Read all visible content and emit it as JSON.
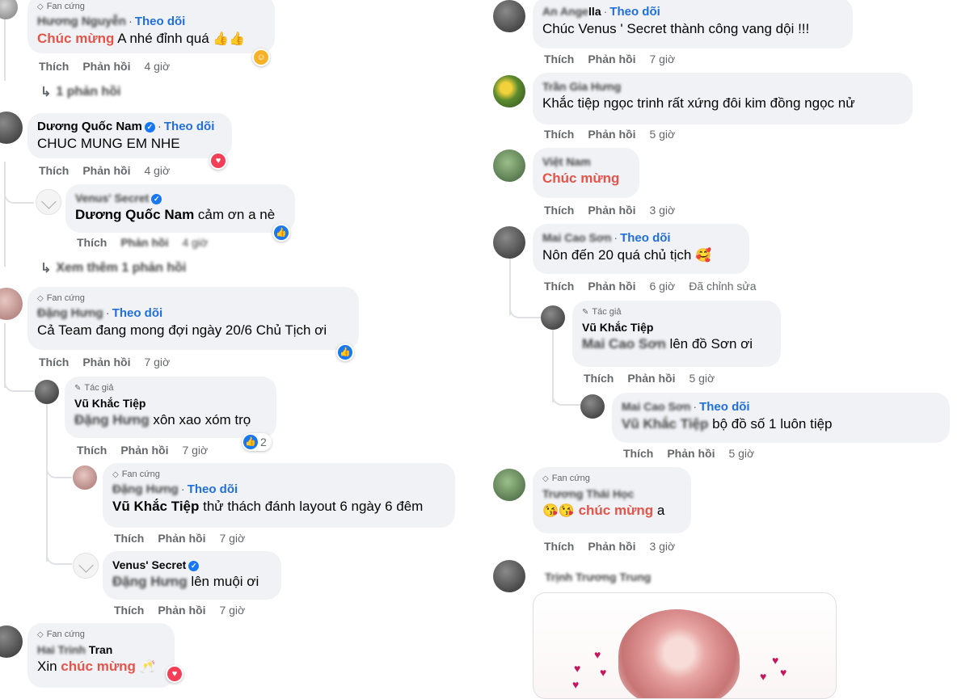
{
  "actions": {
    "like": "Thích",
    "reply": "Phản hồi"
  },
  "left": {
    "c1": {
      "name": "Hương Nguyễn",
      "badge": "Fan cứng",
      "follow": "Theo dõi",
      "text_hl": "Chúc mừng",
      "text_rest": " A nhé đỉnh quá",
      "time": "4 giờ",
      "more": "1 phản hồi"
    },
    "c2": {
      "name": "Dương Quốc Nam",
      "follow": "Theo dõi",
      "text": "CHUC MUNG EM NHE",
      "time": "4 giờ"
    },
    "c2r": {
      "name": "Venus' Secret",
      "mention": "Dương Quốc Nam",
      "text_rest": " cảm ơn a nè",
      "time": "4 giờ"
    },
    "c2more": "Xem thêm 1 phản hồi",
    "c3": {
      "badge": "Fan cứng",
      "name": "Đặng Hưng",
      "follow": "Theo dõi",
      "text": "Cả Team đang mong đợi ngày 20/6 Chủ Tịch ơi",
      "time": "7 giờ"
    },
    "c3r1": {
      "badge": "Tác giả",
      "name": "Vũ Khắc Tiệp",
      "mention": "Đặng Hưng",
      "text_rest": " xôn xao xóm trọ",
      "time": "7 giờ",
      "react_count": "2"
    },
    "c3r2": {
      "badge": "Fan cứng",
      "name": "Đặng Hưng",
      "follow": "Theo dõi",
      "mention": "Vũ Khắc Tiệp",
      "text_rest": " thử thách đánh layout 6 ngày 6 đêm",
      "time": "7 giờ"
    },
    "c3r3": {
      "name": "Venus' Secret",
      "mention": "Đặng Hưng",
      "text_rest": " lên muội ơi",
      "time": "7 giờ"
    },
    "c4": {
      "badge": "Fan cứng",
      "name_blur": "Hai Trinh",
      "name_rest": " Tran",
      "text_pre": "Xin ",
      "text_hl": "chúc mừng"
    }
  },
  "right": {
    "c1": {
      "name_blur": "An Ange",
      "name_rest": "lla",
      "follow": "Theo dõi",
      "text": "Chúc Venus ' Secret thành công vang dội !!!",
      "time": "7 giờ"
    },
    "c2": {
      "name": "Trần Gia Hưng",
      "text": "Khắc tiệp ngọc trinh rất xứng đôi kim đồng ngọc nử",
      "time": "5 giờ"
    },
    "c3": {
      "name": "Việt Nam",
      "text_hl": "Chúc mừng",
      "time": "3 giờ"
    },
    "c4": {
      "name": "Mai Cao Sơn",
      "follow": "Theo dõi",
      "text": "Nôn đến 20 quá chủ tịch",
      "time": "6 giờ",
      "edited": "Đã chỉnh sửa"
    },
    "c4r1": {
      "badge": "Tác giả",
      "name": "Vũ Khắc Tiệp",
      "mention": "Mai Cao Sơn",
      "text_rest": " lên đồ Sơn ơi",
      "time": "5 giờ"
    },
    "c4r2": {
      "name": "Mai Cao Sơn",
      "follow": "Theo dõi",
      "mention": "Vũ Khắc Tiệp",
      "text_rest": " bộ đồ số 1 luôn tiệp",
      "time": "5 giờ"
    },
    "c5": {
      "badge": "Fan cứng",
      "name": "Trương Thái Học",
      "text_hl": "chúc mừng",
      "text_rest": " a",
      "time": "3 giờ"
    },
    "c6": {
      "name": "Trịnh Trương Trung"
    }
  }
}
